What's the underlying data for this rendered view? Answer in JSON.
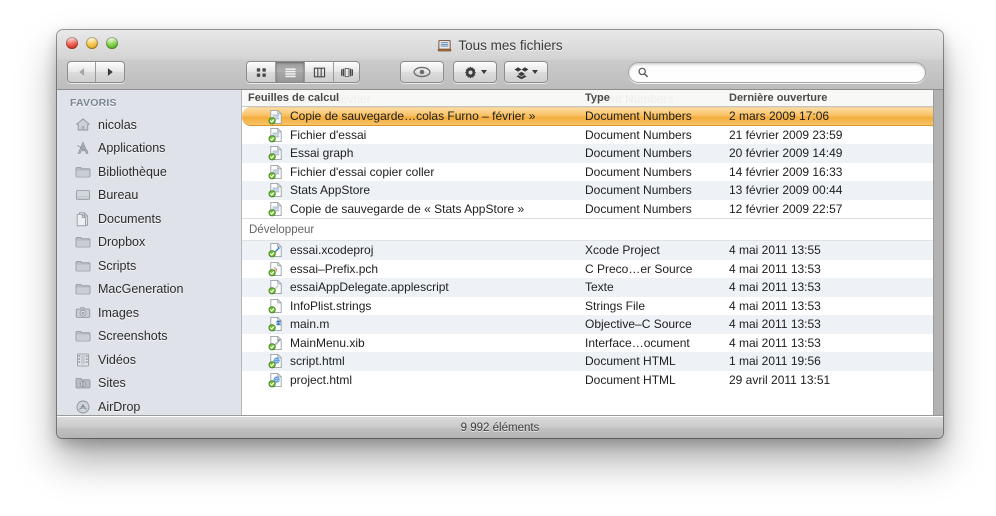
{
  "window": {
    "title": "Tous mes fichiers",
    "title_icon": "all-my-files-icon"
  },
  "traffic_lights": {
    "close": "close-button",
    "minimize": "minimize-button",
    "zoom": "zoom-button"
  },
  "toolbar": {
    "back_label": "Précédent",
    "forward_label": "Suivant",
    "view_modes": [
      {
        "name": "icon-view",
        "label": "Icônes",
        "active": false
      },
      {
        "name": "list-view",
        "label": "Liste",
        "active": true
      },
      {
        "name": "column-view",
        "label": "Colonnes",
        "active": false
      },
      {
        "name": "coverflow-view",
        "label": "Cover Flow",
        "active": false
      }
    ],
    "quicklook_label": "Coup d'œil",
    "action_label": "Action",
    "dropbox_label": "Dropbox"
  },
  "search": {
    "value": "",
    "placeholder": ""
  },
  "sidebar": {
    "header": "FAVORIS",
    "items": [
      {
        "label": "nicolas",
        "icon": "home-icon"
      },
      {
        "label": "Applications",
        "icon": "applications-icon"
      },
      {
        "label": "Bibliothèque",
        "icon": "folder-icon"
      },
      {
        "label": "Bureau",
        "icon": "desktop-icon"
      },
      {
        "label": "Documents",
        "icon": "documents-icon"
      },
      {
        "label": "Dropbox",
        "icon": "folder-icon"
      },
      {
        "label": "Scripts",
        "icon": "folder-icon"
      },
      {
        "label": "MacGeneration",
        "icon": "folder-icon"
      },
      {
        "label": "Images",
        "icon": "camera-icon"
      },
      {
        "label": "Screenshots",
        "icon": "folder-icon"
      },
      {
        "label": "Vidéos",
        "icon": "film-icon"
      },
      {
        "label": "Sites",
        "icon": "sites-folder-icon"
      },
      {
        "label": "AirDrop",
        "icon": "airdrop-icon"
      }
    ]
  },
  "columns": {
    "name": "Feuilles de calcul",
    "type": "Type",
    "date": "Dernière ouverture"
  },
  "scrolled_under_row": {
    "name": "...urno – février",
    "type": "...ment Numbers",
    "date": "..."
  },
  "groups": [
    {
      "label": "Feuilles de calcul",
      "label_in_header": true,
      "rows": [
        {
          "name": "Copie de sauvegarde…colas Furno – février »",
          "type": "Document Numbers",
          "date": "2 mars 2009 17:06",
          "icon": "numbers-doc-icon",
          "selected": true
        },
        {
          "name": "Fichier d'essai",
          "type": "Document Numbers",
          "date": "21 février 2009 23:59",
          "icon": "numbers-doc-icon",
          "selected": false
        },
        {
          "name": "Essai graph",
          "type": "Document Numbers",
          "date": "20 février 2009 14:49",
          "icon": "numbers-doc-icon",
          "selected": false
        },
        {
          "name": "Fichier d'essai copier coller",
          "type": "Document Numbers",
          "date": "14 février 2009 16:33",
          "icon": "numbers-doc-icon",
          "selected": false
        },
        {
          "name": "Stats AppStore",
          "type": "Document Numbers",
          "date": "13 février 2009 00:44",
          "icon": "numbers-doc-icon",
          "selected": false
        },
        {
          "name": "Copie de sauvegarde de « Stats AppStore »",
          "type": "Document Numbers",
          "date": "12 février 2009 22:57",
          "icon": "numbers-doc-icon",
          "selected": false
        }
      ]
    },
    {
      "label": "Développeur",
      "label_in_header": false,
      "rows": [
        {
          "name": "essai.xcodeproj",
          "type": "Xcode Project",
          "date": "4 mai 2011 13:55",
          "icon": "xcode-project-icon",
          "selected": false
        },
        {
          "name": "essai–Prefix.pch",
          "type": "C Preco…er Source",
          "date": "4 mai 2011 13:53",
          "icon": "pch-file-icon",
          "selected": false
        },
        {
          "name": "essaiAppDelegate.applescript",
          "type": "Texte",
          "date": "4 mai 2011 13:53",
          "icon": "applescript-icon",
          "selected": false
        },
        {
          "name": "InfoPlist.strings",
          "type": "Strings File",
          "date": "4 mai 2011 13:53",
          "icon": "strings-file-icon",
          "selected": false
        },
        {
          "name": "main.m",
          "type": "Objective–C Source",
          "date": "4 mai 2011 13:53",
          "icon": "objc-source-icon",
          "selected": false
        },
        {
          "name": "MainMenu.xib",
          "type": "Interface…ocument",
          "date": "4 mai 2011 13:53",
          "icon": "xib-file-icon",
          "selected": false
        },
        {
          "name": "script.html",
          "type": "Document HTML",
          "date": "1 mai 2011 19:56",
          "icon": "html-doc-icon",
          "selected": false
        },
        {
          "name": "project.html",
          "type": "Document HTML",
          "date": "29 avril 2011 13:51",
          "icon": "html-doc-icon",
          "selected": false
        }
      ]
    }
  ],
  "statusbar": {
    "text": "9 992 éléments"
  },
  "colors": {
    "selection_orange": "#f4ad3c",
    "sidebar_bg": "#dfe3e9",
    "row_stripe": "#eef2f7",
    "chrome_top": "#e9e9e9",
    "chrome_bottom": "#bdbdbd"
  }
}
